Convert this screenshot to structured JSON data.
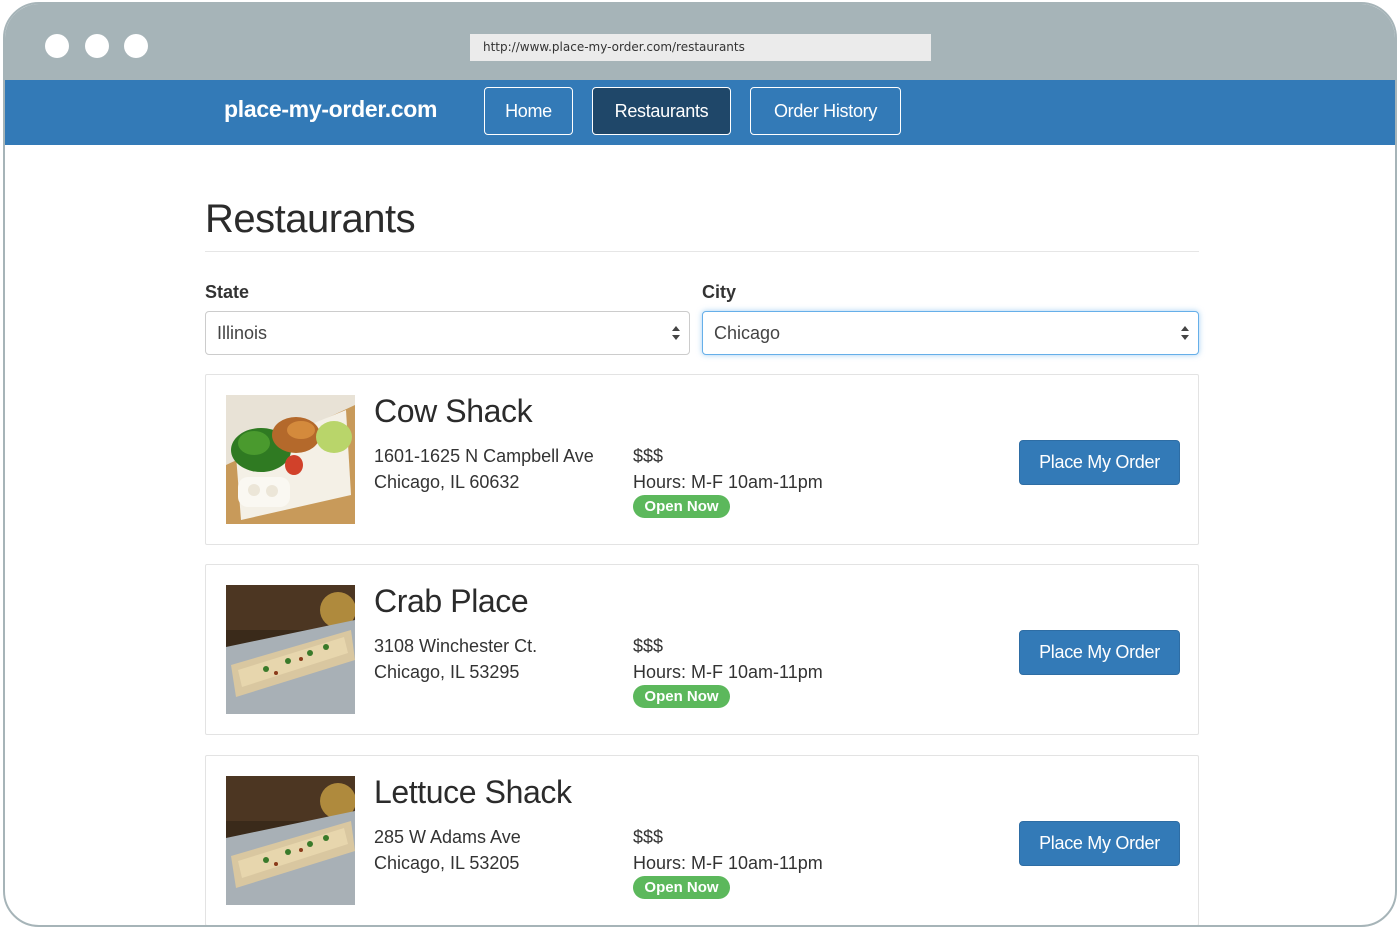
{
  "browser": {
    "url": "http://www.place-my-order.com/restaurants"
  },
  "navbar": {
    "brand": "place-my-order.com",
    "links": [
      {
        "label": "Home",
        "active": false
      },
      {
        "label": "Restaurants",
        "active": true
      },
      {
        "label": "Order History",
        "active": false
      }
    ]
  },
  "page": {
    "title": "Restaurants"
  },
  "filters": {
    "state_label": "State",
    "state_value": "Illinois",
    "city_label": "City",
    "city_value": "Chicago"
  },
  "restaurants": [
    {
      "name": "Cow Shack",
      "address_line1": "1601-1625 N Campbell Ave",
      "address_line2": "Chicago, IL 60632",
      "price": "$$$",
      "hours": "Hours: M-F 10am-11pm",
      "status": "Open Now",
      "button": "Place My Order",
      "image": "food-plate-with-vegetables"
    },
    {
      "name": "Crab Place",
      "address_line1": "3108 Winchester Ct.",
      "address_line2": "Chicago, IL 53295",
      "price": "$$$",
      "hours": "Hours: M-F 10am-11pm",
      "status": "Open Now",
      "button": "Place My Order",
      "image": "crab-cake-dish"
    },
    {
      "name": "Lettuce Shack",
      "address_line1": "285 W Adams Ave",
      "address_line2": "Chicago, IL 53205",
      "price": "$$$",
      "hours": "Hours: M-F 10am-11pm",
      "status": "Open Now",
      "button": "Place My Order",
      "image": "crab-cake-dish"
    }
  ],
  "colors": {
    "navbar": "#337ab7",
    "nav_active": "#1f4769",
    "primary_button": "#337ab7",
    "badge_success": "#5cb85c",
    "browser_chrome": "#a6b4b8"
  }
}
